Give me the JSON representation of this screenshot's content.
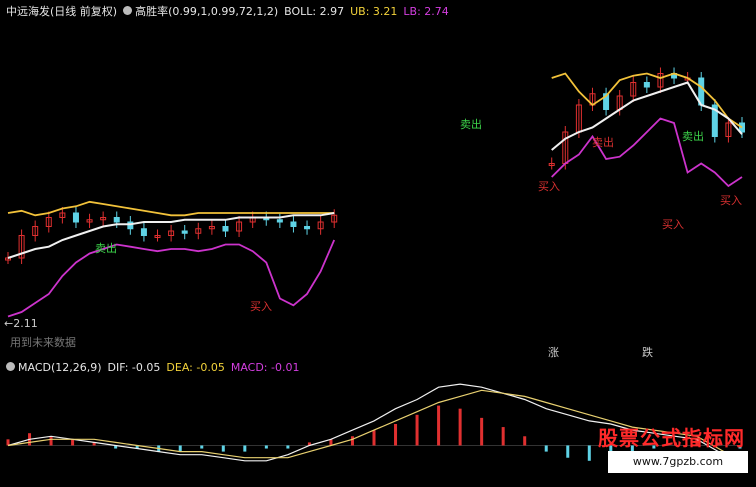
{
  "header": {
    "stock": "中远海发(日线 前复权)",
    "indicator": "高胜率(0.99,1,0.99,72,1,2)",
    "boll": "BOLL: 2.97",
    "ub": "UB: 3.21",
    "lb": "LB: 2.74"
  },
  "price_labels": {
    "low_price": "2.11",
    "future_note": "用到未来数据"
  },
  "signals": {
    "buy": "买入",
    "sell": "卖出",
    "up": "涨",
    "down": "跌"
  },
  "macd_header": {
    "name": "MACD(12,26,9)",
    "dif": "DIF: -0.05",
    "dea": "DEA: -0.05",
    "macd": "MACD: -0.01"
  },
  "watermark": {
    "title": "股票公式指标网",
    "url": "www.7gpzb.com"
  },
  "colors": {
    "upper": "#f2c23a",
    "mid": "#f0f0f0",
    "lower": "#cc33cc",
    "candle_up": "#e03030",
    "candle_down": "#5fd3e6",
    "hist_pos": "#e03030",
    "hist_neg": "#5fd3e6"
  },
  "chart_data": [
    {
      "type": "line",
      "title": "中远海发(日线 前复权)",
      "series": [
        {
          "name": "UB",
          "values": [
            2.62,
            2.63,
            2.61,
            2.62,
            2.64,
            2.65,
            2.67,
            2.66,
            2.65,
            2.64,
            2.63,
            2.62,
            2.61,
            2.61,
            2.62,
            2.62,
            2.62,
            2.62,
            2.62,
            2.62,
            2.62,
            2.62,
            2.62,
            2.62,
            2.62,
            null,
            null,
            null,
            null,
            null,
            null,
            null,
            null,
            null,
            null,
            null,
            null,
            null,
            null,
            null,
            3.22,
            3.24,
            3.16,
            3.1,
            3.14,
            3.21,
            3.23,
            3.24,
            3.22,
            3.24,
            3.22,
            3.18,
            3.12,
            3.04,
            3.0
          ]
        },
        {
          "name": "BOLL",
          "values": [
            2.42,
            2.44,
            2.46,
            2.47,
            2.5,
            2.52,
            2.54,
            2.56,
            2.57,
            2.57,
            2.58,
            2.58,
            2.58,
            2.59,
            2.59,
            2.59,
            2.59,
            2.6,
            2.6,
            2.6,
            2.6,
            2.61,
            2.61,
            2.61,
            2.62,
            null,
            null,
            null,
            null,
            null,
            null,
            null,
            null,
            null,
            null,
            null,
            null,
            null,
            null,
            null,
            2.9,
            2.95,
            2.98,
            3.0,
            3.04,
            3.08,
            3.12,
            3.14,
            3.16,
            3.18,
            3.2,
            3.1,
            3.08,
            3.04,
            2.97
          ]
        },
        {
          "name": "LB",
          "values": [
            2.16,
            2.18,
            2.22,
            2.26,
            2.34,
            2.4,
            2.44,
            2.46,
            2.48,
            2.47,
            2.46,
            2.45,
            2.46,
            2.46,
            2.45,
            2.46,
            2.48,
            2.48,
            2.45,
            2.4,
            2.24,
            2.21,
            2.26,
            2.36,
            2.5,
            null,
            null,
            null,
            null,
            null,
            null,
            null,
            null,
            null,
            null,
            null,
            null,
            null,
            null,
            null,
            2.78,
            2.84,
            2.88,
            2.96,
            2.86,
            2.87,
            2.92,
            2.98,
            3.04,
            3.02,
            2.8,
            2.84,
            2.8,
            2.74,
            2.78
          ]
        },
        {
          "name": "Close",
          "values": [
            2.42,
            2.52,
            2.56,
            2.6,
            2.62,
            2.58,
            2.59,
            2.6,
            2.58,
            2.55,
            2.52,
            2.52,
            2.54,
            2.53,
            2.55,
            2.56,
            2.54,
            2.58,
            2.6,
            2.59,
            2.58,
            2.56,
            2.55,
            2.58,
            2.61,
            null,
            null,
            null,
            null,
            null,
            null,
            null,
            null,
            null,
            null,
            null,
            null,
            null,
            null,
            null,
            2.84,
            2.98,
            3.1,
            3.15,
            3.08,
            3.14,
            3.2,
            3.18,
            3.24,
            3.22,
            3.22,
            3.1,
            2.96,
            3.02,
            2.98
          ]
        }
      ]
    },
    {
      "type": "bar",
      "title": "MACD(12,26,9)",
      "series": [
        {
          "name": "MACD",
          "values": [
            0.02,
            0.04,
            0.03,
            0.02,
            0.01,
            -0.01,
            -0.01,
            -0.02,
            -0.02,
            -0.01,
            -0.02,
            -0.02,
            -0.01,
            -0.01,
            0.01,
            0.02,
            0.03,
            0.05,
            0.07,
            0.1,
            0.13,
            0.12,
            0.09,
            0.06,
            0.03,
            -0.02,
            -0.04,
            -0.05,
            -0.03,
            -0.02,
            -0.01,
            0.01,
            0.02,
            0.01,
            -0.01
          ]
        },
        {
          "name": "DIF",
          "values": [
            0.0,
            0.02,
            0.03,
            0.02,
            0.01,
            0.0,
            -0.01,
            -0.02,
            -0.03,
            -0.03,
            -0.04,
            -0.05,
            -0.05,
            -0.03,
            0.0,
            0.02,
            0.05,
            0.08,
            0.12,
            0.15,
            0.19,
            0.2,
            0.19,
            0.17,
            0.15,
            0.12,
            0.1,
            0.08,
            0.07,
            0.05,
            0.04,
            0.03,
            0.02,
            -0.02,
            -0.05
          ]
        },
        {
          "name": "DEA",
          "values": [
            0.0,
            0.01,
            0.02,
            0.02,
            0.02,
            0.01,
            0.0,
            -0.01,
            -0.02,
            -0.02,
            -0.03,
            -0.04,
            -0.04,
            -0.04,
            -0.02,
            0.0,
            0.02,
            0.05,
            0.08,
            0.11,
            0.14,
            0.16,
            0.18,
            0.17,
            0.16,
            0.14,
            0.12,
            0.1,
            0.08,
            0.06,
            0.05,
            0.04,
            0.03,
            -0.01,
            -0.05
          ]
        }
      ]
    }
  ]
}
